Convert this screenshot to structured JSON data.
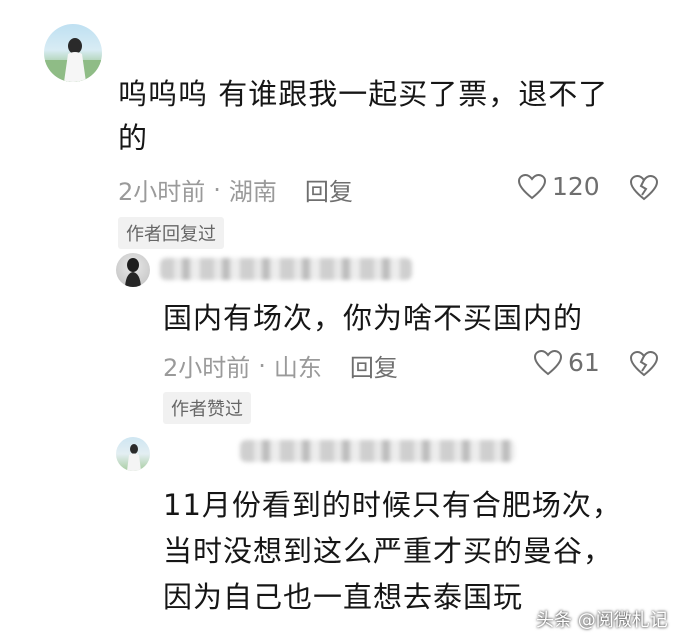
{
  "comment": {
    "text": "呜呜呜 有谁跟我一起买了票，退不了的",
    "line1": "呜呜呜 有谁跟我一起买了票，退不了",
    "line2": "的",
    "time": "2小时前",
    "dot": "·",
    "location": "湖南",
    "reply_label": "回复",
    "likes": "120",
    "tag": "作者回复过"
  },
  "reply1": {
    "text": "国内有场次，你为啥不买国内的",
    "time": "2小时前",
    "dot": "·",
    "location": "山东",
    "reply_label": "回复",
    "likes": "61",
    "tag": "作者赞过"
  },
  "reply2": {
    "line1": "11月份看到的时候只有合肥场次，",
    "line2": "当时没想到这么严重才买的曼谷，",
    "line3": "因为自己也一直想去泰国玩"
  },
  "watermark": "头条 @阅微札记",
  "icons": [
    "avatar",
    "heart-icon",
    "dislike-icon"
  ],
  "colors": {
    "text": "#161616",
    "meta": "#9a9a9a",
    "tag_bg": "#f1f1f1"
  }
}
